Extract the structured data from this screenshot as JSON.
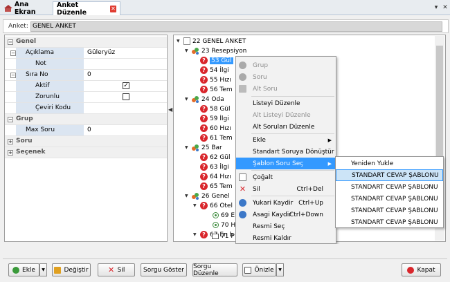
{
  "tabs": [
    {
      "label": "Ana Ekran"
    },
    {
      "label": "Anket Düzenle"
    }
  ],
  "header": {
    "label": "Anket:",
    "value": "GENEL ANKET"
  },
  "props": {
    "genel": "Genel",
    "aciklama": {
      "name": "Açıklama",
      "value": "Güleryüz"
    },
    "not": {
      "name": "Not",
      "value": ""
    },
    "sirano": {
      "name": "Sıra No",
      "value": "0"
    },
    "aktif": {
      "name": "Aktif",
      "checked": true
    },
    "zorunlu": {
      "name": "Zorunlu",
      "checked": false
    },
    "ceviri": {
      "name": "Çeviri Kodu",
      "value": ""
    },
    "grup": "Grup",
    "maxsoru": {
      "name": "Max Soru",
      "value": "0"
    },
    "soru": "Soru",
    "secenek": "Seçenek"
  },
  "tree": [
    {
      "label": "22 GENEL ANKET"
    },
    {
      "label": "23 Resepsiyon"
    },
    {
      "label": "53 Gül"
    },
    {
      "label": "54 İlgi"
    },
    {
      "label": "55 Hızı"
    },
    {
      "label": "56 Tem"
    },
    {
      "label": "24 Oda"
    },
    {
      "label": "58 Gül"
    },
    {
      "label": "59 İlgi"
    },
    {
      "label": "60 Hızı"
    },
    {
      "label": "61 Tem"
    },
    {
      "label": "25 Bar"
    },
    {
      "label": "62 Gül"
    },
    {
      "label": "63 İlgi"
    },
    {
      "label": "64 Hızı"
    },
    {
      "label": "65 Tem"
    },
    {
      "label": "26 Genel"
    },
    {
      "label": "66 Otel"
    },
    {
      "label": "69 E"
    },
    {
      "label": "70 H"
    },
    {
      "label": "67 En b"
    },
    {
      "label": "71 P"
    }
  ],
  "contextMenu": [
    {
      "label": "Grup"
    },
    {
      "label": "Soru"
    },
    {
      "label": "Alt Soru"
    },
    {
      "label": "Listeyi Düzenle"
    },
    {
      "label": "Alt Listeyi Düzenle"
    },
    {
      "label": "Alt Soruları Düzenle"
    },
    {
      "label": "Ekle"
    },
    {
      "label": "Standart Soruya Dönüştür"
    },
    {
      "label": "Şablon Soru Seç"
    },
    {
      "label": "Çoğalt"
    },
    {
      "label": "Sil",
      "shortcut": "Ctrl+Del"
    },
    {
      "label": "Yukari Kaydir",
      "shortcut": "Ctrl+Up"
    },
    {
      "label": "Asagi Kaydir",
      "shortcut": "Ctrl+Down"
    },
    {
      "label": "Resmi Seç"
    },
    {
      "label": "Resmi Kaldır"
    }
  ],
  "submenu": [
    {
      "label": "Yeniden Yukle"
    },
    {
      "label": "STANDART CEVAP ŞABLONU"
    },
    {
      "label": "STANDART CEVAP ŞABLONU"
    },
    {
      "label": "STANDART CEVAP ŞABLONU"
    },
    {
      "label": "STANDART CEVAP ŞABLONU"
    },
    {
      "label": "STANDART CEVAP ŞABLONU"
    }
  ],
  "buttons": {
    "ekle": "Ekle",
    "degistir": "Değiştir",
    "sil": "Sil",
    "sorgugoster": "Sorgu Göster",
    "sorgudz": "Sorgu Düzenle",
    "onizle": "Önizle",
    "kapat": "Kapat"
  },
  "icons": {
    "tabClose": "close-icon",
    "home": "home-icon"
  },
  "colors": {
    "accent": "#3399ff",
    "question": "#d9262c"
  }
}
